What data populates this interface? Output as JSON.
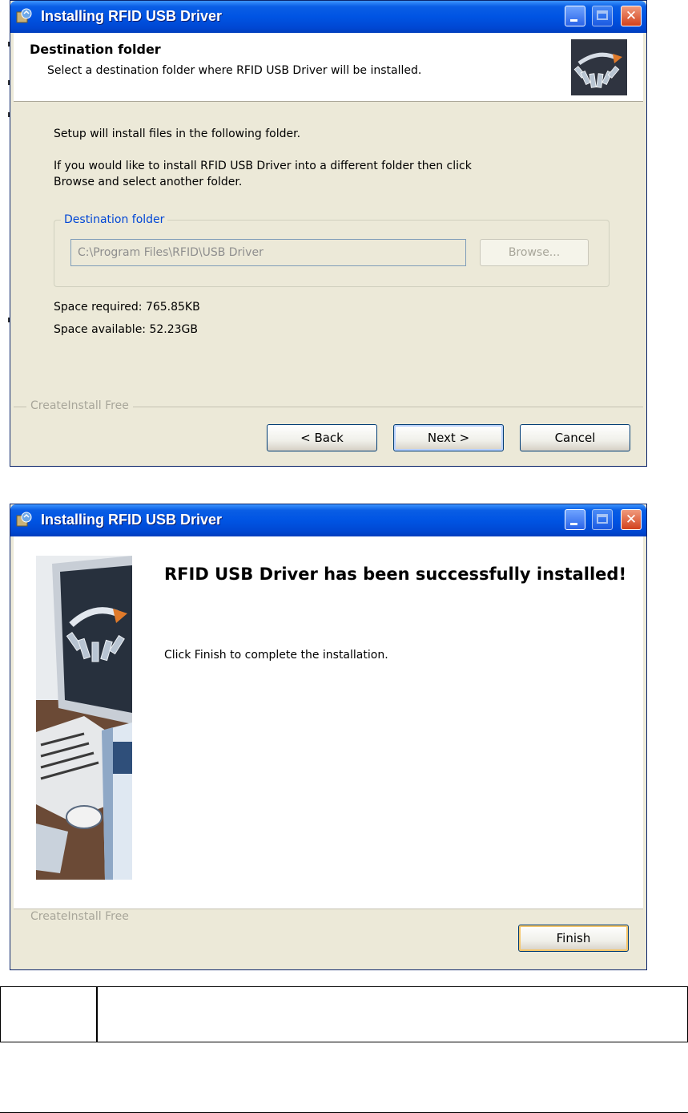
{
  "window1": {
    "title": "Installing RFID USB Driver",
    "header_title": "Destination folder",
    "header_subtitle": "Select a destination folder where RFID USB Driver will be installed.",
    "intro_text": "Setup will install files in the following folder.",
    "instruction_line1": "If you would like to install RFID USB Driver into a different folder then click",
    "instruction_line2": "Browse and select another folder.",
    "group_label": "Destination folder",
    "path_value": "C:\\Program Files\\RFID\\USB Driver",
    "browse_label": "Browse...",
    "space_required": "Space required: 765.85KB",
    "space_available": "Space available: 52.23GB",
    "footer_brand": "CreateInstall Free",
    "back_label": "< Back",
    "next_label": "Next >",
    "cancel_label": "Cancel"
  },
  "window2": {
    "title": "Installing RFID USB Driver",
    "success_title": "RFID USB Driver has been successfully installed!",
    "success_message": "Click Finish to complete the installation.",
    "footer_brand": "CreateInstall Free",
    "finish_label": "Finish"
  },
  "icons": {
    "title_icon": "installer-icon",
    "header_logo": "createinstall-logo-icon",
    "banner": "computer-illustration"
  },
  "colors": {
    "titlebar_blue": "#0054e3",
    "dialog_bg": "#ece9d8",
    "close_red": "#d2411c",
    "groupbox_label": "#0046d5"
  }
}
